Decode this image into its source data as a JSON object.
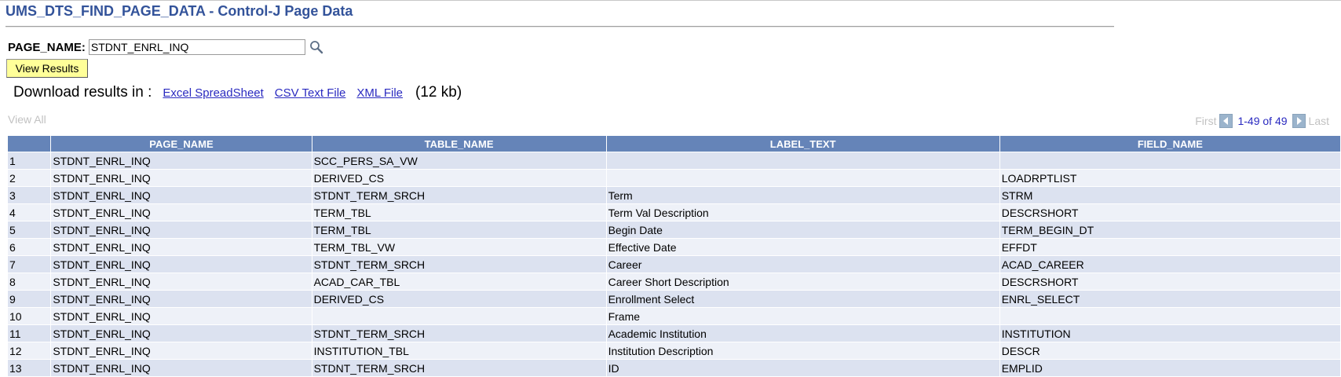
{
  "page": {
    "title": "UMS_DTS_FIND_PAGE_DATA - Control-J Page Data"
  },
  "search": {
    "label": "PAGE_NAME:",
    "value": "STDNT_ENRL_INQ"
  },
  "view_results_label": "View Results",
  "download": {
    "text": "Download results in :",
    "excel": "Excel SpreadSheet",
    "csv": "CSV Text File",
    "xml": "XML File",
    "size": "(12 kb)"
  },
  "view_all": "View All",
  "nav": {
    "first": "First",
    "count": "1-49 of 49",
    "last": "Last"
  },
  "columns": [
    "",
    "PAGE_NAME",
    "TABLE_NAME",
    "LABEL_TEXT",
    "FIELD_NAME"
  ],
  "rows": [
    [
      "1",
      "STDNT_ENRL_INQ",
      "SCC_PERS_SA_VW",
      "",
      ""
    ],
    [
      "2",
      "STDNT_ENRL_INQ",
      "DERIVED_CS",
      "",
      "LOADRPTLIST"
    ],
    [
      "3",
      "STDNT_ENRL_INQ",
      "STDNT_TERM_SRCH",
      "Term",
      "STRM"
    ],
    [
      "4",
      "STDNT_ENRL_INQ",
      "TERM_TBL",
      "Term Val Description",
      "DESCRSHORT"
    ],
    [
      "5",
      "STDNT_ENRL_INQ",
      "TERM_TBL",
      "Begin Date",
      "TERM_BEGIN_DT"
    ],
    [
      "6",
      "STDNT_ENRL_INQ",
      "TERM_TBL_VW",
      "Effective Date",
      "EFFDT"
    ],
    [
      "7",
      "STDNT_ENRL_INQ",
      "STDNT_TERM_SRCH",
      "Career",
      "ACAD_CAREER"
    ],
    [
      "8",
      "STDNT_ENRL_INQ",
      "ACAD_CAR_TBL",
      "Career Short Description",
      "DESCRSHORT"
    ],
    [
      "9",
      "STDNT_ENRL_INQ",
      "DERIVED_CS",
      "Enrollment Select",
      "ENRL_SELECT"
    ],
    [
      "10",
      "STDNT_ENRL_INQ",
      "",
      "Frame",
      ""
    ],
    [
      "11",
      "STDNT_ENRL_INQ",
      "STDNT_TERM_SRCH",
      "Academic Institution",
      "INSTITUTION"
    ],
    [
      "12",
      "STDNT_ENRL_INQ",
      "INSTITUTION_TBL",
      "Institution Description",
      "DESCR"
    ],
    [
      "13",
      "STDNT_ENRL_INQ",
      "STDNT_TERM_SRCH",
      "ID",
      "EMPLID"
    ]
  ],
  "icons": {
    "lookup": "magnifier-icon",
    "prev": "arrow-left-icon",
    "next": "arrow-right-icon"
  },
  "colors": {
    "header_bg": "#6584b8",
    "row_odd": "#dce2f0",
    "row_even": "#eef1f8",
    "title": "#33539a",
    "link": "#2a2ac0",
    "button_bg": "#ffff99"
  }
}
